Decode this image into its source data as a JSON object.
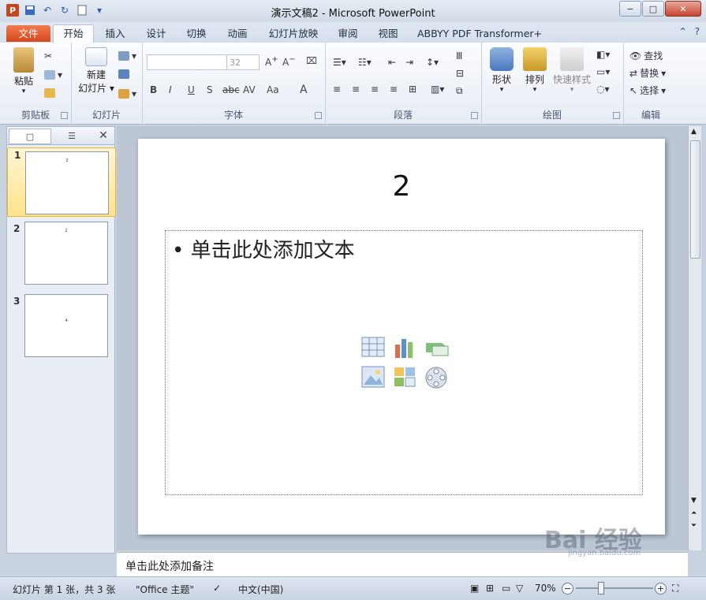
{
  "window": {
    "title": "演示文稿2 - Microsoft PowerPoint",
    "app_icon": "P",
    "controls": {
      "minimize": "−",
      "maximize": "□",
      "close": "✕"
    }
  },
  "ribbon_tabs": [
    "文件",
    "开始",
    "插入",
    "设计",
    "切换",
    "动画",
    "幻灯片放映",
    "审阅",
    "视图",
    "ABBYY PDF Transformer+"
  ],
  "ribbon": {
    "clipboard": {
      "label": "剪贴板",
      "paste": "粘贴"
    },
    "slides": {
      "label": "幻灯片",
      "new_slide_1": "新建",
      "new_slide_2": "幻灯片 ▾"
    },
    "font": {
      "label": "字体",
      "font_name": "",
      "font_size": "32",
      "bold": "B",
      "italic": "I",
      "underline": "U",
      "shadow": "S",
      "strike": "abc",
      "spacing": "AV",
      "case": "Aa",
      "color": "A"
    },
    "paragraph": {
      "label": "段落"
    },
    "drawing": {
      "label": "绘图",
      "shapes": "形状",
      "arrange": "排列",
      "quick_styles": "快速样式"
    },
    "editing": {
      "label": "编辑",
      "find": "查找",
      "replace": "替换",
      "select": "选择"
    }
  },
  "slide_panel": {
    "thumbs": [
      {
        "number": "1",
        "text": "2"
      },
      {
        "number": "2",
        "text": "2"
      },
      {
        "number": "3",
        "text": "4"
      }
    ]
  },
  "slide": {
    "title": "2",
    "bullet": "单击此处添加文本"
  },
  "notes": {
    "placeholder": "单击此处添加备注"
  },
  "status": {
    "slide_info": "幻灯片 第 1 张，共 3 张",
    "theme": "\"Office 主题\"",
    "language": "中文(中国)",
    "zoom": "70%"
  },
  "watermark": {
    "text": "Bai 经验",
    "url": "jingyan.baidu.com"
  },
  "colors": {
    "file_tab": "#d5471d",
    "accent": "#2a5aa8",
    "selected_thumb": "#ffe38a"
  }
}
